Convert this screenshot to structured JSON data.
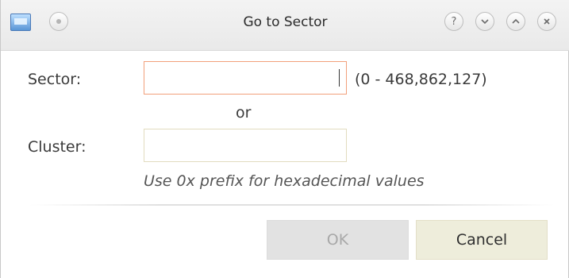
{
  "window": {
    "title": "Go to Sector",
    "titlebar_buttons": [
      {
        "name": "help-icon",
        "glyph": "?"
      },
      {
        "name": "minimize-icon",
        "glyph": "⌄"
      },
      {
        "name": "maximize-icon",
        "glyph": "⌃"
      },
      {
        "name": "close-icon",
        "glyph": "×"
      }
    ]
  },
  "form": {
    "sector_label": "Sector:",
    "sector_value": "",
    "sector_range": "(0 - 468,862,127)",
    "or_text": "or",
    "cluster_label": "Cluster:",
    "cluster_value": "",
    "hint": "Use 0x prefix for hexadecimal values"
  },
  "buttons": {
    "ok": "OK",
    "cancel": "Cancel"
  },
  "colors": {
    "focused_border": "#f2a07b",
    "input_border": "#e2dcbf",
    "ok_disabled_bg": "#e2e2e2",
    "cancel_bg": "#eeeddb"
  }
}
